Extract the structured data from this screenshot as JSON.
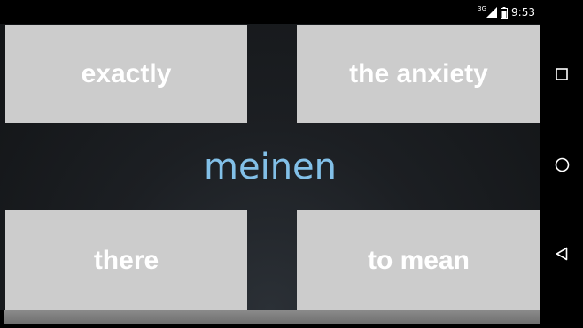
{
  "status_bar": {
    "network_label": "3G",
    "time": "9:53",
    "icons": [
      "signal-icon",
      "battery-icon"
    ]
  },
  "quiz": {
    "prompt_word": "meinen",
    "options": [
      {
        "label": "exactly"
      },
      {
        "label": "the anxiety"
      },
      {
        "label": "there"
      },
      {
        "label": "to mean"
      }
    ]
  },
  "nav_bar": {
    "buttons": [
      "recents-icon",
      "home-icon",
      "back-icon"
    ]
  },
  "colors": {
    "tile_bg": "#cccccc",
    "tile_text": "#ffffff",
    "prompt_text": "#82c0e8",
    "background": "#1c1f23"
  }
}
